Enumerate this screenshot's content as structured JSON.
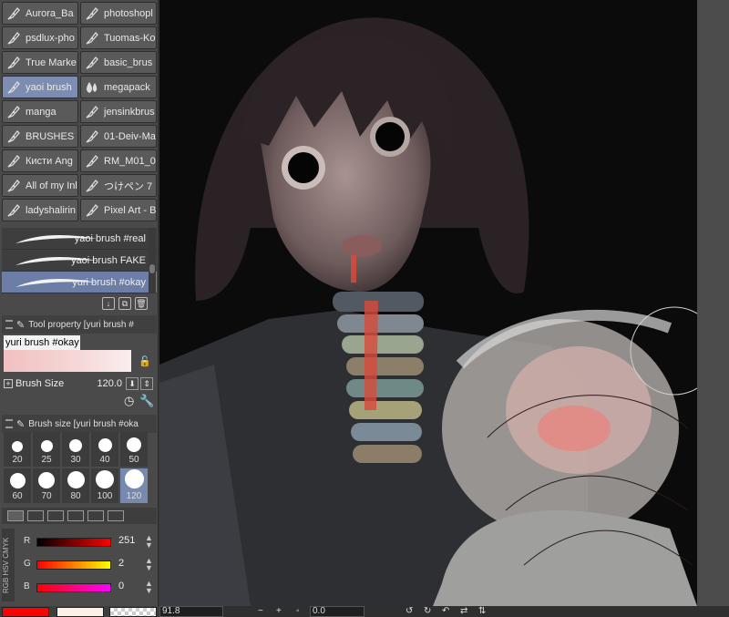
{
  "brush_tabs": {
    "items": [
      {
        "label": "Aurora_Ba",
        "icon": "pen-nib-icon"
      },
      {
        "label": "photoshopl",
        "icon": "pen-nib-icon"
      },
      {
        "label": "psdlux-pho",
        "icon": "pen-nib-icon"
      },
      {
        "label": "Tuomas-Ko",
        "icon": "pen-nib-icon"
      },
      {
        "label": "True Marke",
        "icon": "pen-nib-icon"
      },
      {
        "label": "basic_brus",
        "icon": "pen-nib-icon"
      },
      {
        "label": "yaoi brush",
        "icon": "pen-nib-icon"
      },
      {
        "label": "megapack",
        "icon": "water-drops-icon"
      },
      {
        "label": "manga",
        "icon": "pen-nib-icon"
      },
      {
        "label": "jensinkbrus",
        "icon": "pen-nib-icon"
      },
      {
        "label": "BRUSHES",
        "icon": "pen-nib-icon"
      },
      {
        "label": "01-Deiv-Ma",
        "icon": "pen-nib-icon"
      },
      {
        "label": "Кисти Ang",
        "icon": "pen-nib-icon"
      },
      {
        "label": "RM_M01_0",
        "icon": "pen-nib-icon"
      },
      {
        "label": "All of my Inl",
        "icon": "pen-nib-icon"
      },
      {
        "label": "つけペン 7",
        "icon": "pen-nib-icon"
      },
      {
        "label": "ladyshalirin",
        "icon": "pen-nib-icon"
      },
      {
        "label": "Pixel Art - B",
        "icon": "pen-nib-icon"
      }
    ],
    "active_label": "yaoi brush"
  },
  "sub_tools": {
    "items": [
      {
        "label": "yaoi brush #real"
      },
      {
        "label": "yaoi brush FAKE"
      },
      {
        "label": "yuri brush #okay"
      }
    ],
    "active_label": "yuri brush #okay"
  },
  "tool_property": {
    "title": "Tool property [yuri brush #",
    "tool_name": "yuri brush #okay",
    "brush_size_label": "Brush Size",
    "brush_size_value": "120.0"
  },
  "brush_size_panel": {
    "title": "Brush size [yuri brush #oka",
    "sizes": [
      "20",
      "25",
      "30",
      "40",
      "50",
      "60",
      "70",
      "80",
      "100",
      "120"
    ],
    "active_size": "120"
  },
  "color_slider": {
    "mode_labels": "RGB HSV CMYK",
    "channels": [
      {
        "label": "R",
        "value": "251"
      },
      {
        "label": "G",
        "value": "2"
      },
      {
        "label": "B",
        "value": "0"
      }
    ],
    "main_color": "#fb0200",
    "sub_color": "#fdeee6"
  },
  "status_bar": {
    "zoom": "91.8",
    "minus": "−",
    "plus": "+",
    "rotation": "0.0"
  }
}
